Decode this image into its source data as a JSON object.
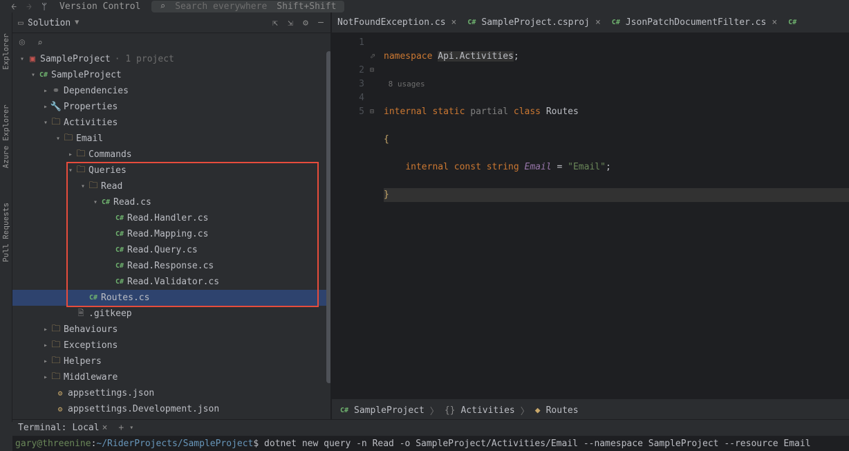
{
  "topbar": {
    "vcs_icon_label": "Version Control",
    "search_placeholder": "Search everywhere",
    "search_shortcut": "Shift+Shift"
  },
  "left_rail": {
    "tab1": "Explorer",
    "tab2": "Azure Explorer",
    "tab3": "Pull Requests"
  },
  "solution_header": {
    "title": "Solution"
  },
  "tree": {
    "root": "SampleProject",
    "root_meta": "· 1 project",
    "proj": "SampleProject",
    "deps": "Dependencies",
    "props": "Properties",
    "activities": "Activities",
    "email": "Email",
    "commands": "Commands",
    "queries": "Queries",
    "read": "Read",
    "read_cs": "Read.cs",
    "read_handler": "Read.Handler.cs",
    "read_mapping": "Read.Mapping.cs",
    "read_query": "Read.Query.cs",
    "read_response": "Read.Response.cs",
    "read_validator": "Read.Validator.cs",
    "routes": "Routes.cs",
    "gitkeep": ".gitkeep",
    "behaviours": "Behaviours",
    "exceptions": "Exceptions",
    "helpers": "Helpers",
    "middleware": "Middleware",
    "appsettings": "appsettings.json",
    "appsettings_dev": "appsettings.Development.json"
  },
  "editor_tabs": {
    "tab1": "NotFoundException.cs",
    "tab2": "SampleProject.csproj",
    "tab3": "JsonPatchDocumentFilter.cs"
  },
  "code": {
    "line1_kw": "namespace",
    "line1_ns": "Api.Activities",
    "usages": "8 usages",
    "line2_internal": "internal",
    "line2_static": "static",
    "line2_partial": "partial",
    "line2_class": "class",
    "line2_name": "Routes",
    "line4_internal": "internal",
    "line4_const": "const",
    "line4_string": "string",
    "line4_field": "Email",
    "line4_value": "\"Email\""
  },
  "breadcrumb": {
    "item1": "SampleProject",
    "item2": "Activities",
    "item3": "Routes"
  },
  "terminal": {
    "header": "Terminal:",
    "tab": "Local",
    "user": "gary@threenine",
    "path": "~/RiderProjects/SampleProject",
    "prompt": "$",
    "command": "dotnet new query -n Read -o SampleProject/Activities/Email --namespace SampleProject --resource Email"
  }
}
